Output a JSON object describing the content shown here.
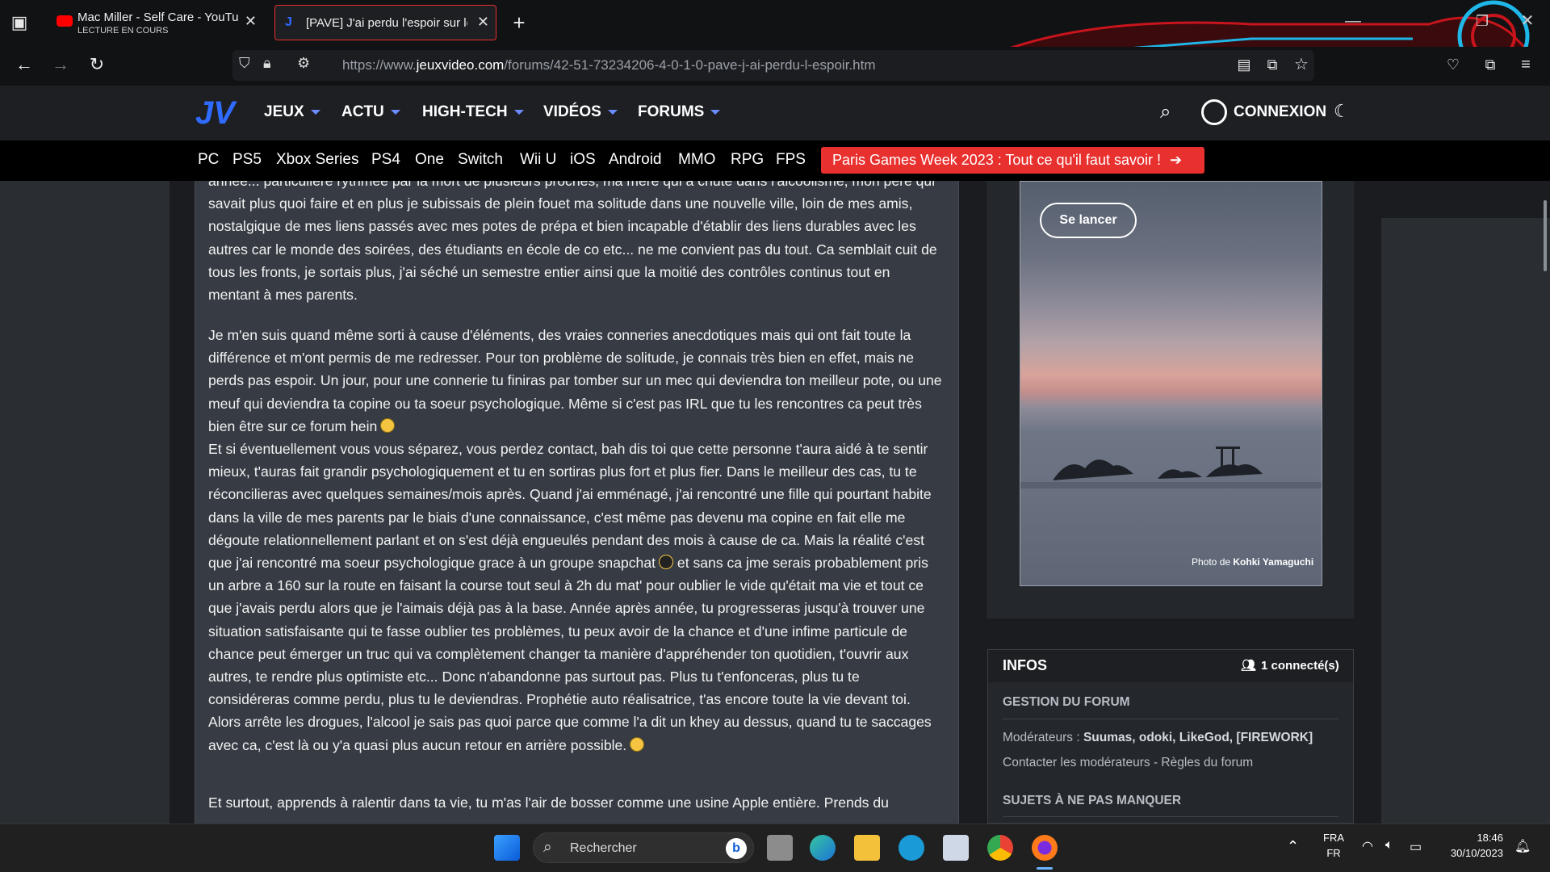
{
  "browser": {
    "tabs": [
      {
        "title": "Mac Miller - Self Care - YouTube",
        "subtitle": "LECTURE EN COURS",
        "active": false
      },
      {
        "title": "[PAVE] J'ai perdu l'espoir sur le",
        "active": true
      }
    ],
    "new_tab_symbol": "+",
    "url": {
      "prefix": "https://www.",
      "domain": "jeuxvideo.com",
      "path": "/forums/42-51-73234206-4-0-1-0-pave-j-ai-perdu-l-espoir.htm"
    }
  },
  "site": {
    "logo": "JV",
    "nav": [
      "JEUX",
      "ACTU",
      "HIGH-TECH",
      "VIDÉOS",
      "FORUMS"
    ],
    "login": "CONNEXION",
    "platforms": [
      "PC",
      "PS5",
      "Xbox Series",
      "PS4",
      "One",
      "Switch",
      "Wii U",
      "iOS",
      "Android",
      "MMO",
      "RPG",
      "FPS"
    ],
    "promo": "Paris Games Week 2023 : Tout ce qu'il faut savoir !",
    "promo_arrow": "➔"
  },
  "post": {
    "p1": "année... particulière rythmée par la mort de plusieurs proches, ma mère qui a chuté dans l'alcoolisme, mon père qui savait plus quoi faire et en plus je subissais de plein fouet ma solitude dans une nouvelle ville, loin de mes amis, nostalgique de mes liens passés avec mes potes de prépa et bien incapable d'établir des liens durables avec les autres car le monde des soirées, des étudiants en école de co etc... ne me convient pas du tout. Ca semblait cuit de tous les fronts, je sortais plus, j'ai séché un semestre entier ainsi que la moitié des contrôles continus tout en mentant à mes parents.",
    "p2a": "Je m'en suis quand même sorti à cause d'éléments, des vraies conneries anecdotiques mais qui ont fait toute la différence et m'ont permis de me redresser. Pour ton problème de solitude, je connais très bien en effet, mais ne perds pas espoir. Un jour, pour une connerie tu finiras par tomber sur un mec qui deviendra ton meilleur pote, ou une meuf qui deviendra ta copine ou ta soeur psychologique. Même si c'est pas IRL que tu les rencontres ca peut très bien être sur ce forum hein",
    "p2b": "Et si éventuellement vous vous séparez, vous perdez contact, bah dis toi que cette personne t'aura aidé à te sentir mieux, t'auras fait grandir psychologiquement et tu en sortiras plus fort et plus fier. Dans le meilleur des cas, tu te réconcilieras avec quelques semaines/mois après. Quand j'ai emménagé, j'ai rencontré une fille qui pourtant habite dans la ville de mes parents par le biais d'une connaissance, c'est même pas devenu ma copine en fait elle me dégoute relationnellement parlant et on s'est déjà engueulés pendant des mois à cause de ca. Mais la réalité c'est que j'ai rencontré ma soeur psychologique grace à un groupe snapchat",
    "p2c": "et sans ca jme serais probablement pris un arbre a 160 sur la route en faisant la course tout seul à 2h du mat' pour oublier le vide qu'était ma vie et tout ce que j'avais perdu alors que je l'aimais déjà pas à la base. Année après année, tu progresseras jusqu'à trouver une situation satisfaisante qui te fasse oublier tes problèmes, tu peux avoir de la chance et d'une infime particule de chance peut émerger un truc qui va complètement changer ta manière d'appréhender ton quotidien, t'ouvrir aux autres, te rendre plus optimiste etc... Donc n'abandonne pas surtout pas. Plus tu t'enfonceras, plus tu te considéreras comme perdu, plus tu le deviendras. Prophétie auto réalisatrice, t'as encore toute la vie devant toi. Alors arrête les drogues, l'alcool je sais pas quoi parce que comme l'a dit un khey au dessus, quand tu te saccages avec ca, c'est là ou y'a quasi plus aucun retour en arrière possible.",
    "p3": "Et surtout, apprends à ralentir dans ta vie, tu m'as l'air de bosser comme une usine Apple entière. Prends du"
  },
  "ad": {
    "button": "Se lancer",
    "credit_prefix": "Photo de ",
    "credit_name": "Kohki Yamaguchi"
  },
  "infos": {
    "title": "INFOS",
    "connected": "1 connecté(s)",
    "gestion": "GESTION DU FORUM",
    "moderators_label": "Modérateurs : ",
    "moderators": "Suumas, odoki, LikeGod, [FIREWORK]",
    "contact": "Contacter les modérateurs",
    "separator": " - ",
    "rules": "Règles du forum",
    "must_read": "SUJETS À NE PAS MANQUER"
  },
  "taskbar": {
    "search_placeholder": "Rechercher",
    "lang1": "FRA",
    "lang2": "FR",
    "time": "18:46",
    "date": "30/10/2023"
  },
  "colors": {
    "accent_red": "#e8302e",
    "jv_blue": "#2f6bff",
    "nav_bg": "#1d1f23"
  }
}
